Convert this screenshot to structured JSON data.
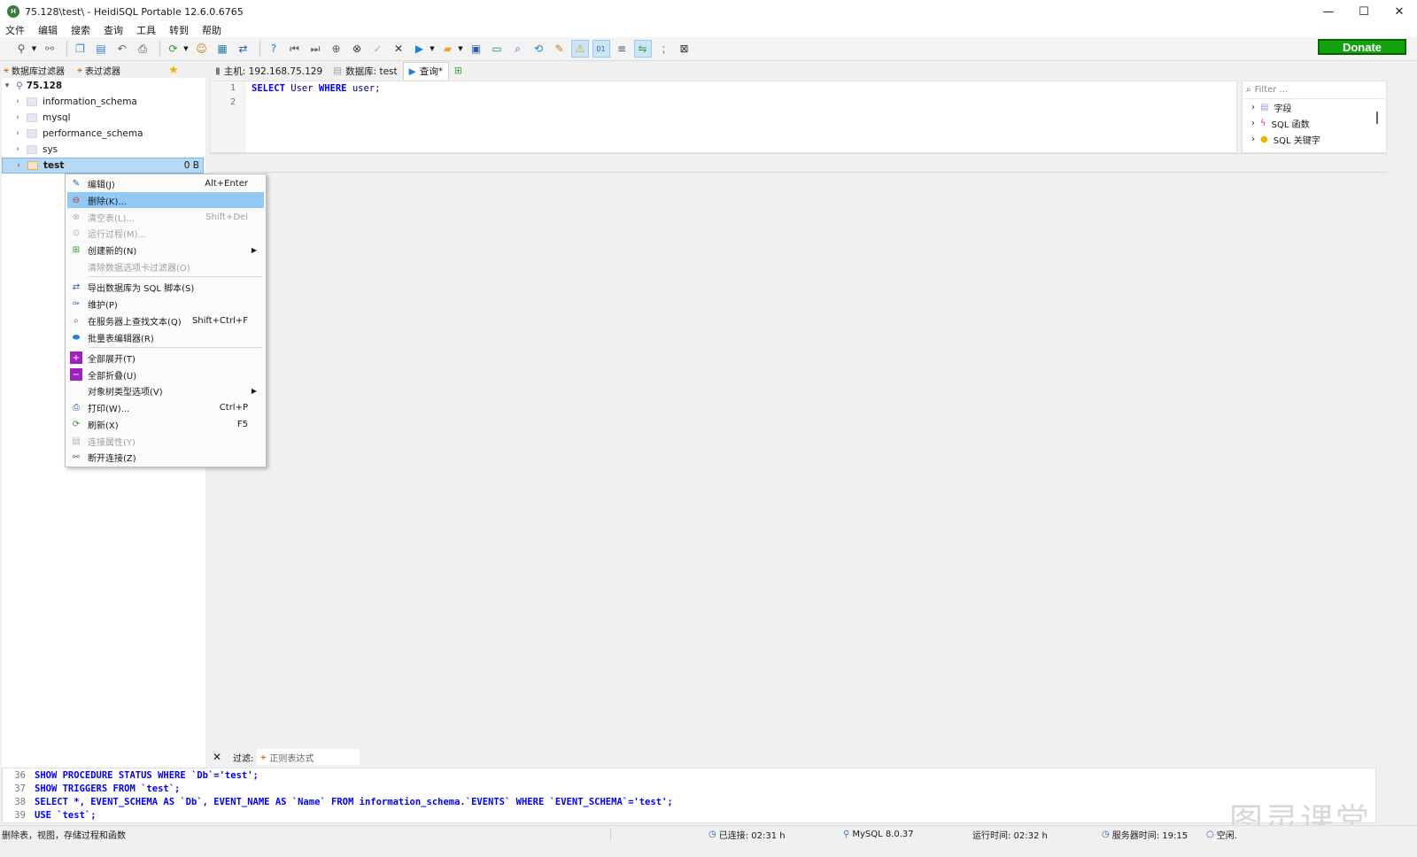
{
  "window": {
    "title": "75.128\\test\\ - HeidiSQL Portable 12.6.0.6765",
    "minimize": "—",
    "maximize": "☐",
    "close": "✕"
  },
  "menu": [
    "文件",
    "编辑",
    "搜索",
    "查询",
    "工具",
    "转到",
    "帮助"
  ],
  "donate_label": "Donate",
  "filter_tabs": {
    "db_filter": "数据库过滤器",
    "table_filter": "表过滤器"
  },
  "tree": {
    "server": "75.128",
    "databases": [
      "information_schema",
      "mysql",
      "performance_schema",
      "sys"
    ],
    "selected_db": "test",
    "selected_size": "0 B"
  },
  "query_tabs": {
    "host": "主机: 192.168.75.129",
    "database": "数据库: test",
    "query": "查询*"
  },
  "editor": {
    "line_numbers": [
      "1",
      "2"
    ],
    "line1": {
      "kw1": "SELECT",
      "id1": "User",
      "kw2": "WHERE",
      "id2": "user;"
    }
  },
  "helper": {
    "filter_placeholder": "Filter ...",
    "items": [
      "字段",
      "SQL 函数",
      "SQL 关键字"
    ]
  },
  "results_filter": {
    "label": "过滤:",
    "regex": "正则表达式"
  },
  "log": [
    {
      "ln": "36",
      "text": "SHOW PROCEDURE STATUS WHERE `Db`='test';"
    },
    {
      "ln": "37",
      "text": "SHOW TRIGGERS FROM `test`;"
    },
    {
      "ln": "38",
      "text": "SELECT *, EVENT_SCHEMA AS `Db`, EVENT_NAME AS `Name` FROM information_schema.`EVENTS` WHERE `EVENT_SCHEMA`='test';"
    },
    {
      "ln": "39",
      "text": "USE `test`;"
    }
  ],
  "context_menu": [
    {
      "label": "编辑(J)",
      "shortcut": "Alt+Enter"
    },
    {
      "label": "删除(K)...",
      "shortcut": ""
    },
    {
      "label": "清空表(L)...",
      "shortcut": "Shift+Del"
    },
    {
      "label": "运行过程(M)...",
      "shortcut": ""
    },
    {
      "label": "创建新的(N)",
      "shortcut": ""
    },
    {
      "label": "清除数据选项卡过滤器(O)",
      "shortcut": ""
    },
    {
      "label": "导出数据库为 SQL 脚本(S)",
      "shortcut": ""
    },
    {
      "label": "维护(P)",
      "shortcut": ""
    },
    {
      "label": "在服务器上查找文本(Q)",
      "shortcut": "Shift+Ctrl+F"
    },
    {
      "label": "批量表编辑器(R)",
      "shortcut": ""
    },
    {
      "label": "全部展开(T)",
      "shortcut": ""
    },
    {
      "label": "全部折叠(U)",
      "shortcut": ""
    },
    {
      "label": "对象树类型选项(V)",
      "shortcut": ""
    },
    {
      "label": "打印(W)...",
      "shortcut": "Ctrl+P"
    },
    {
      "label": "刷新(X)",
      "shortcut": "F5"
    },
    {
      "label": "连接属性(Y)",
      "shortcut": ""
    },
    {
      "label": "断开连接(Z)",
      "shortcut": ""
    }
  ],
  "status": {
    "hint": "删除表，视图，存储过程和函数",
    "connected": "已连接: 02:31 h",
    "version": "MySQL 8.0.37",
    "uptime": "运行时间: 02:32 h",
    "server_time": "服务器时间: 19:15",
    "idle": "空闲."
  },
  "watermark": "图灵课堂",
  "colors": {
    "accent": "#91c9f7",
    "keyword": "#0000ff",
    "donate": "#13a10e",
    "selection": "#b6d9f5"
  }
}
